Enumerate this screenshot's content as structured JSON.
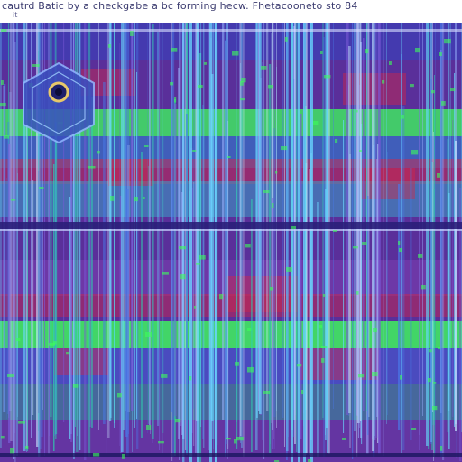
{
  "header": {
    "title": "cautrd Batic by a checkgabe a bc forming hecw. Fhetacooneto sto 84",
    "subtitle": "it"
  },
  "colors": {
    "background": "#5a2f9a",
    "band_green": "#3cff5a",
    "streak_cyan": "#6ad8ff",
    "blotch_red": "#d0284a",
    "divider_navy": "#2a1f7a"
  },
  "icons": {
    "glyph": "hexagon-ring-icon"
  }
}
